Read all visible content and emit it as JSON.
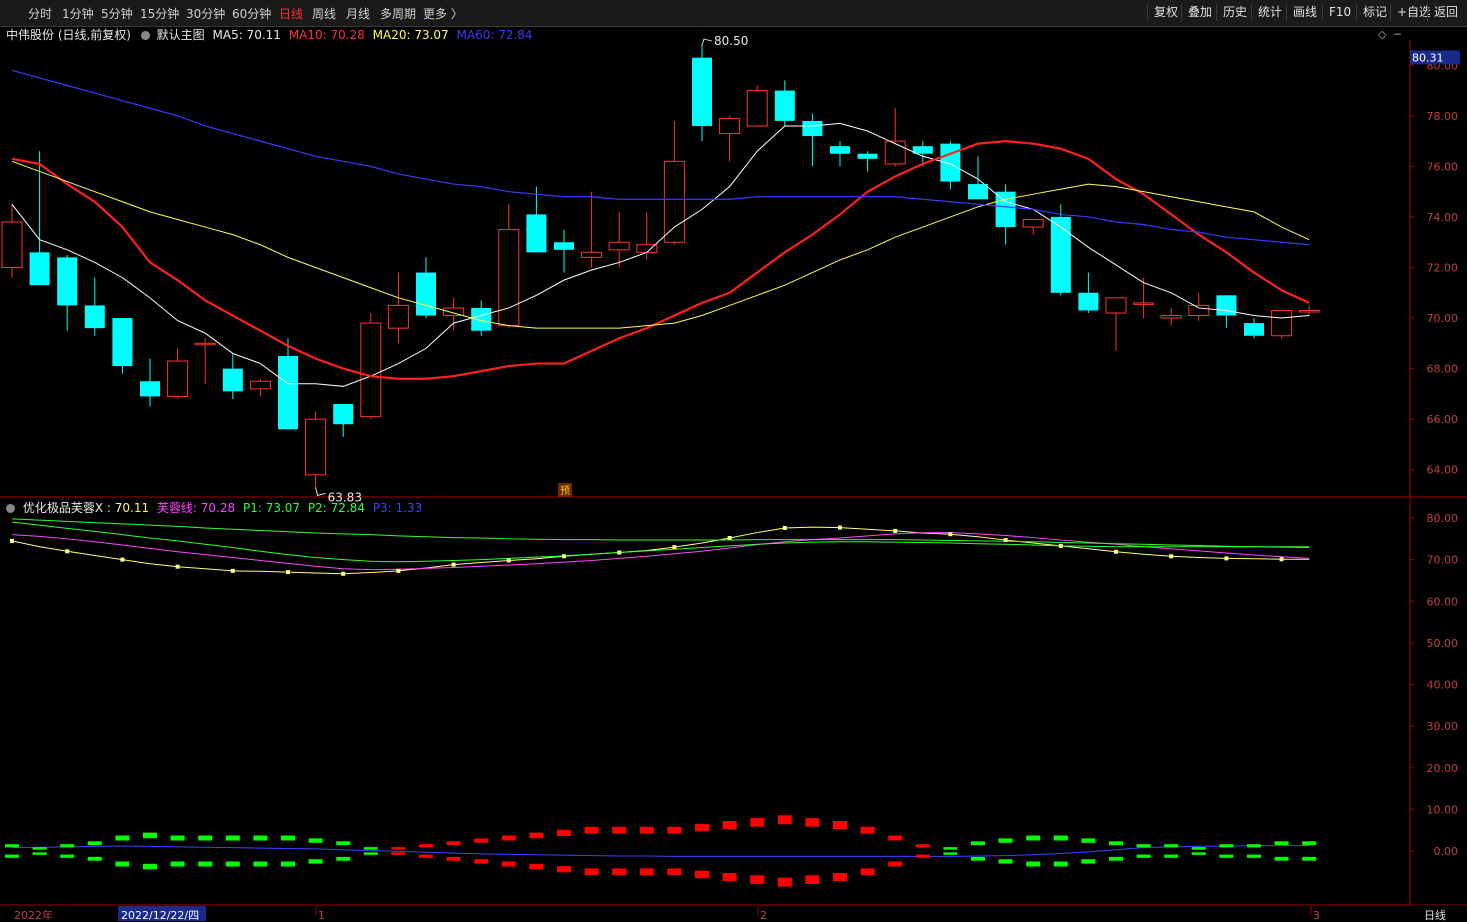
{
  "toolbar": {
    "periods": [
      "分时",
      "1分钟",
      "5分钟",
      "15分钟",
      "30分钟",
      "60分钟",
      "日线",
      "周线",
      "月线",
      "多周期",
      "更多 〉"
    ],
    "active_period": "日线",
    "right_buttons": [
      "复权",
      "叠加",
      "历史",
      "统计",
      "画线",
      "F10",
      "标记",
      "+自选",
      "返回"
    ]
  },
  "main_legend": {
    "stock": "中伟股份 (日线,前复权)",
    "template": "默认主图",
    "ma5": "MA5: 70.11",
    "ma10": "MA10: 70.28",
    "ma20": "MA20: 73.07",
    "ma60": "MA60: 72.84"
  },
  "sub_legend": {
    "name": "优化极品芙蓉X",
    "x": "70.11",
    "fr": "芙蓉线: 70.28",
    "p1": "P1: 73.07",
    "p2": "P2: 72.84",
    "p3": "P3: 1.33"
  },
  "colors": {
    "up": "#ff3232",
    "down": "#00ffff",
    "ma5": "#ffffff",
    "ma10": "#ff2020",
    "ma20": "#ffff55",
    "ma60": "#3a3aff",
    "axis": "#a00000",
    "label": "#c04040"
  },
  "chart_data": [
    {
      "type": "candlestick",
      "title": "中伟股份 (日线,前复权)",
      "ylim": [
        63,
        81
      ],
      "y_ticks": [
        "80.00",
        "78.00",
        "76.00",
        "74.00",
        "72.00",
        "70.00",
        "68.00",
        "66.00",
        "64.00"
      ],
      "current_price": "80.31",
      "annotations": {
        "high": "80.50",
        "low": "63.83",
        "pre_mark": "预"
      },
      "x_labels": [
        "2022年",
        "2022/12/22/四",
        "1",
        "2",
        "3"
      ],
      "candles": [
        {
          "o": 72.0,
          "h": 74.5,
          "l": 71.6,
          "c": 73.8
        },
        {
          "o": 72.6,
          "h": 76.6,
          "l": 71.4,
          "c": 71.3
        },
        {
          "o": 72.4,
          "h": 72.5,
          "l": 69.5,
          "c": 70.5
        },
        {
          "o": 70.5,
          "h": 71.6,
          "l": 69.3,
          "c": 69.6
        },
        {
          "o": 70.0,
          "h": 70.0,
          "l": 67.8,
          "c": 68.1
        },
        {
          "o": 67.5,
          "h": 68.4,
          "l": 66.5,
          "c": 66.9
        },
        {
          "o": 66.9,
          "h": 68.8,
          "l": 66.8,
          "c": 68.3
        },
        {
          "o": 69.0,
          "h": 69.2,
          "l": 67.4,
          "c": 69.0
        },
        {
          "o": 68.0,
          "h": 68.6,
          "l": 66.8,
          "c": 67.1
        },
        {
          "o": 67.2,
          "h": 67.6,
          "l": 66.9,
          "c": 67.5
        },
        {
          "o": 68.5,
          "h": 69.2,
          "l": 65.7,
          "c": 65.6
        },
        {
          "o": 63.8,
          "h": 66.3,
          "l": 63.3,
          "c": 66.0
        },
        {
          "o": 66.6,
          "h": 66.6,
          "l": 65.3,
          "c": 65.8
        },
        {
          "o": 66.1,
          "h": 70.2,
          "l": 66.0,
          "c": 69.8
        },
        {
          "o": 69.6,
          "h": 71.8,
          "l": 69.0,
          "c": 70.5
        },
        {
          "o": 71.8,
          "h": 72.4,
          "l": 70.0,
          "c": 70.1
        },
        {
          "o": 70.1,
          "h": 70.8,
          "l": 69.5,
          "c": 70.4
        },
        {
          "o": 70.4,
          "h": 70.7,
          "l": 69.3,
          "c": 69.5
        },
        {
          "o": 69.7,
          "h": 74.5,
          "l": 69.6,
          "c": 73.5
        },
        {
          "o": 74.1,
          "h": 75.2,
          "l": 72.6,
          "c": 72.6
        },
        {
          "o": 73.0,
          "h": 73.5,
          "l": 71.8,
          "c": 72.7
        },
        {
          "o": 72.4,
          "h": 75.0,
          "l": 72.0,
          "c": 72.6
        },
        {
          "o": 72.7,
          "h": 74.2,
          "l": 72.0,
          "c": 73.0
        },
        {
          "o": 72.6,
          "h": 74.2,
          "l": 72.3,
          "c": 72.9
        },
        {
          "o": 73.0,
          "h": 77.8,
          "l": 72.9,
          "c": 76.2
        },
        {
          "o": 80.3,
          "h": 80.8,
          "l": 77.0,
          "c": 77.6
        },
        {
          "o": 77.3,
          "h": 78.0,
          "l": 76.2,
          "c": 77.9
        },
        {
          "o": 77.6,
          "h": 79.2,
          "l": 77.6,
          "c": 79.0
        },
        {
          "o": 79.0,
          "h": 79.4,
          "l": 77.6,
          "c": 77.8
        },
        {
          "o": 77.8,
          "h": 78.1,
          "l": 76.0,
          "c": 77.2
        },
        {
          "o": 76.8,
          "h": 77.0,
          "l": 76.0,
          "c": 76.5
        },
        {
          "o": 76.5,
          "h": 76.6,
          "l": 75.8,
          "c": 76.3
        },
        {
          "o": 76.1,
          "h": 78.3,
          "l": 76.0,
          "c": 77.0
        },
        {
          "o": 76.8,
          "h": 77.0,
          "l": 76.0,
          "c": 76.5
        },
        {
          "o": 76.9,
          "h": 77.0,
          "l": 75.1,
          "c": 75.4
        },
        {
          "o": 75.3,
          "h": 76.4,
          "l": 74.8,
          "c": 74.7
        },
        {
          "o": 75.0,
          "h": 75.3,
          "l": 72.9,
          "c": 73.6
        },
        {
          "o": 73.6,
          "h": 73.9,
          "l": 73.3,
          "c": 73.9
        },
        {
          "o": 74.0,
          "h": 74.5,
          "l": 70.9,
          "c": 71.0
        },
        {
          "o": 71.0,
          "h": 71.8,
          "l": 70.2,
          "c": 70.3
        },
        {
          "o": 70.2,
          "h": 70.5,
          "l": 68.7,
          "c": 70.8
        },
        {
          "o": 70.6,
          "h": 71.6,
          "l": 70.0,
          "c": 70.6
        },
        {
          "o": 70.0,
          "h": 70.4,
          "l": 69.7,
          "c": 70.1
        },
        {
          "o": 70.1,
          "h": 71.0,
          "l": 69.9,
          "c": 70.5
        },
        {
          "o": 70.9,
          "h": 70.9,
          "l": 69.6,
          "c": 70.1
        },
        {
          "o": 69.8,
          "h": 70.0,
          "l": 69.2,
          "c": 69.3
        },
        {
          "o": 69.3,
          "h": 70.3,
          "l": 69.2,
          "c": 70.3
        },
        {
          "o": 70.3,
          "h": 70.5,
          "l": 70.1,
          "c": 70.3
        }
      ],
      "series": [
        {
          "name": "MA5",
          "values": [
            74.5,
            73.1,
            72.7,
            72.2,
            71.6,
            70.8,
            69.9,
            69.4,
            68.6,
            68.2,
            67.4,
            67.4,
            67.3,
            67.7,
            68.2,
            68.8,
            69.8,
            70.1,
            70.4,
            70.9,
            71.5,
            71.9,
            72.2,
            72.6,
            73.6,
            74.3,
            75.2,
            76.6,
            77.6,
            77.6,
            77.7,
            77.4,
            76.9,
            76.4,
            76.1,
            75.5,
            74.6,
            74.3,
            73.6,
            72.8,
            72.1,
            71.4,
            71.0,
            70.4,
            70.3,
            70.1,
            70.0,
            70.1
          ]
        },
        {
          "name": "MA10",
          "values": [
            76.3,
            76.1,
            75.3,
            74.6,
            73.6,
            72.2,
            71.5,
            70.7,
            70.1,
            69.5,
            68.9,
            68.4,
            68.0,
            67.7,
            67.6,
            67.6,
            67.7,
            67.9,
            68.1,
            68.2,
            68.2,
            68.7,
            69.2,
            69.6,
            70.1,
            70.6,
            71.0,
            71.8,
            72.6,
            73.3,
            74.1,
            75.0,
            75.6,
            76.1,
            76.5,
            76.9,
            77.0,
            76.9,
            76.7,
            76.3,
            75.5,
            74.9,
            74.1,
            73.3,
            72.6,
            71.8,
            71.1,
            70.6
          ]
        },
        {
          "name": "MA20",
          "values": [
            76.2,
            75.8,
            75.4,
            75.0,
            74.6,
            74.2,
            73.9,
            73.6,
            73.3,
            72.9,
            72.4,
            72.0,
            71.6,
            71.2,
            70.8,
            70.5,
            70.2,
            69.9,
            69.7,
            69.6,
            69.6,
            69.6,
            69.6,
            69.7,
            69.8,
            70.1,
            70.5,
            70.9,
            71.3,
            71.8,
            72.3,
            72.7,
            73.2,
            73.6,
            74.0,
            74.4,
            74.7,
            74.9,
            75.1,
            75.3,
            75.2,
            75.0,
            74.8,
            74.6,
            74.4,
            74.2,
            73.6,
            73.1
          ]
        },
        {
          "name": "MA60",
          "values": [
            79.8,
            79.5,
            79.2,
            78.9,
            78.6,
            78.3,
            78.0,
            77.6,
            77.3,
            77.0,
            76.7,
            76.4,
            76.2,
            76.0,
            75.7,
            75.5,
            75.3,
            75.2,
            75.0,
            74.9,
            74.8,
            74.8,
            74.7,
            74.7,
            74.7,
            74.7,
            74.7,
            74.8,
            74.8,
            74.8,
            74.8,
            74.8,
            74.8,
            74.7,
            74.6,
            74.5,
            74.4,
            74.3,
            74.1,
            74.0,
            73.8,
            73.7,
            73.5,
            73.4,
            73.2,
            73.1,
            73.0,
            72.9
          ]
        }
      ]
    },
    {
      "type": "line",
      "title": "优化极品芙蓉X",
      "ylim": [
        -10,
        82
      ],
      "y_ticks": [
        "80.00",
        "70.00",
        "60.00",
        "50.00",
        "40.00",
        "30.00",
        "20.00",
        "10.00",
        "0.00"
      ],
      "series": [
        {
          "name": "优化极品芙蓉X",
          "values": [
            74.5,
            73.1,
            72.0,
            71.0,
            70.0,
            69.0,
            68.3,
            67.8,
            67.3,
            67.2,
            67.0,
            66.8,
            66.6,
            66.9,
            67.3,
            68.0,
            68.8,
            69.3,
            69.8,
            70.2,
            70.8,
            71.3,
            71.7,
            72.2,
            73.0,
            74.0,
            75.2,
            76.5,
            77.6,
            77.8,
            77.7,
            77.3,
            76.9,
            76.4,
            76.1,
            75.5,
            74.7,
            74.0,
            73.3,
            72.6,
            71.9,
            71.3,
            70.8,
            70.5,
            70.3,
            70.2,
            70.1,
            70.1
          ]
        },
        {
          "name": "芙蓉线",
          "values": [
            76.0,
            75.6,
            75.0,
            74.3,
            73.5,
            72.7,
            71.9,
            71.2,
            70.5,
            69.8,
            69.1,
            68.4,
            67.8,
            67.6,
            67.7,
            67.9,
            68.1,
            68.4,
            68.7,
            69.0,
            69.4,
            69.8,
            70.3,
            70.8,
            71.4,
            72.0,
            72.8,
            73.6,
            74.3,
            74.8,
            75.2,
            75.7,
            76.2,
            76.5,
            76.5,
            76.2,
            75.8,
            75.3,
            74.7,
            74.2,
            73.7,
            73.1,
            72.6,
            72.1,
            71.6,
            71.1,
            70.7,
            70.3
          ]
        },
        {
          "name": "P1",
          "values": [
            79.0,
            78.3,
            77.5,
            76.8,
            76.0,
            75.2,
            74.5,
            73.7,
            72.9,
            72.0,
            71.2,
            70.5,
            70.0,
            69.6,
            69.5,
            69.6,
            69.8,
            70.0,
            70.3,
            70.6,
            70.9,
            71.3,
            71.7,
            72.1,
            72.5,
            72.9,
            73.3,
            73.7,
            74.0,
            74.2,
            74.3,
            74.3,
            74.2,
            74.1,
            74.0,
            73.8,
            73.7,
            73.5,
            73.3,
            73.2,
            73.1,
            73.1,
            73.1,
            73.1,
            73.1,
            73.1,
            73.1,
            73.1
          ]
        },
        {
          "name": "P2",
          "values": [
            79.8,
            79.5,
            79.2,
            78.9,
            78.6,
            78.3,
            78.0,
            77.6,
            77.3,
            77.0,
            76.7,
            76.4,
            76.2,
            76.0,
            75.7,
            75.5,
            75.3,
            75.2,
            75.0,
            74.9,
            74.8,
            74.8,
            74.7,
            74.7,
            74.7,
            74.7,
            74.7,
            74.8,
            74.8,
            74.8,
            74.8,
            74.8,
            74.8,
            74.7,
            74.6,
            74.5,
            74.4,
            74.3,
            74.1,
            74.0,
            73.8,
            73.7,
            73.5,
            73.4,
            73.2,
            73.1,
            73.0,
            72.9
          ]
        },
        {
          "name": "P3",
          "values": [
            0.8,
            0.9,
            1.0,
            1.1,
            1.2,
            1.1,
            1.0,
            0.9,
            0.8,
            0.7,
            0.6,
            0.5,
            0.3,
            0.1,
            -0.1,
            -0.3,
            -0.5,
            -0.7,
            -0.8,
            -0.9,
            -1.0,
            -1.1,
            -1.2,
            -1.2,
            -1.3,
            -1.3,
            -1.3,
            -1.3,
            -1.3,
            -1.3,
            -1.3,
            -1.3,
            -1.3,
            -1.3,
            -1.3,
            -1.2,
            -1.1,
            -0.9,
            -0.6,
            -0.2,
            0.3,
            0.8,
            1.0,
            1.1,
            1.2,
            1.3,
            1.3,
            1.33
          ]
        }
      ],
      "bars": [
        -2,
        -1,
        -2,
        -3,
        -5,
        -6,
        -5,
        -5,
        -5,
        -5,
        -5,
        -4,
        -3,
        -1,
        1,
        2,
        3,
        4,
        5,
        6,
        7,
        8,
        8,
        8,
        8,
        9,
        10,
        11,
        12,
        11,
        10,
        8,
        5,
        2,
        -1,
        -3,
        -4,
        -5,
        -5,
        -4,
        -3,
        -2,
        -2,
        -1,
        -2,
        -2,
        -3,
        -3
      ]
    }
  ]
}
